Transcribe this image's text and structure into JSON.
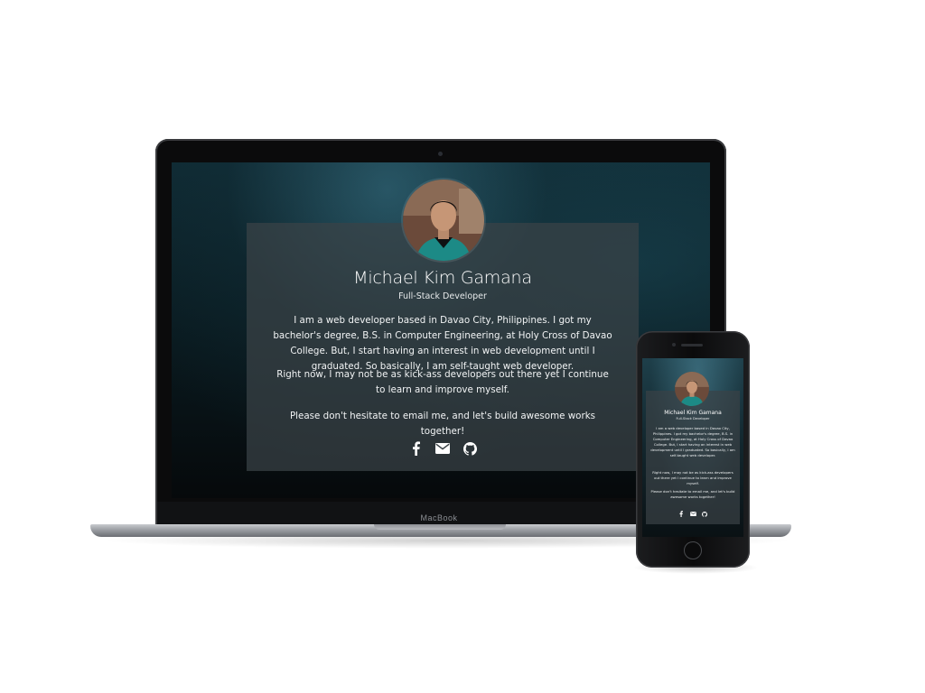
{
  "laptop": {
    "brand_label": "MacBook",
    "profile": {
      "name": "Michael Kim Gamana",
      "role": "Full-Stack Developer",
      "paragraphs": [
        "I am a web developer based in Davao City, Philippines. I got my bachelor's degree, B.S. in Computer Engineering, at Holy Cross of Davao College. But, I start having an interest in web development until I graduated. So basically, I am self-taught web developer.",
        "Right now, I may not be as kick-ass developers out there yet I continue to learn and improve myself.",
        "Please don't hesitate to email me, and let's build awesome works together!"
      ],
      "social_icons": [
        "facebook-icon",
        "email-icon",
        "github-icon"
      ]
    }
  },
  "phone": {
    "profile": {
      "name": "Michael Kim Gamana",
      "role": "Full-Stack Developer",
      "paragraphs": [
        "I am a web developer based in Davao City, Philippines. I got my bachelor's degree, B.S. in Computer Engineering, at Holy Cross of Davao College. But, I start having an interest in web development until I graduated. So basically, I am self-taught web developer.",
        "Right now, I may not be as kick-ass developers out there yet I continue to learn and improve myself.",
        "Please don't hesitate to email me, and let's build awesome works together!"
      ],
      "social_icons": [
        "facebook-icon",
        "email-icon",
        "github-icon"
      ]
    }
  },
  "colors": {
    "background": "#ffffff",
    "screen_dark": "#0a1c22",
    "card_overlay": "#3a4246",
    "text": "#ffffff",
    "device_frame": "#0b0b0c"
  }
}
